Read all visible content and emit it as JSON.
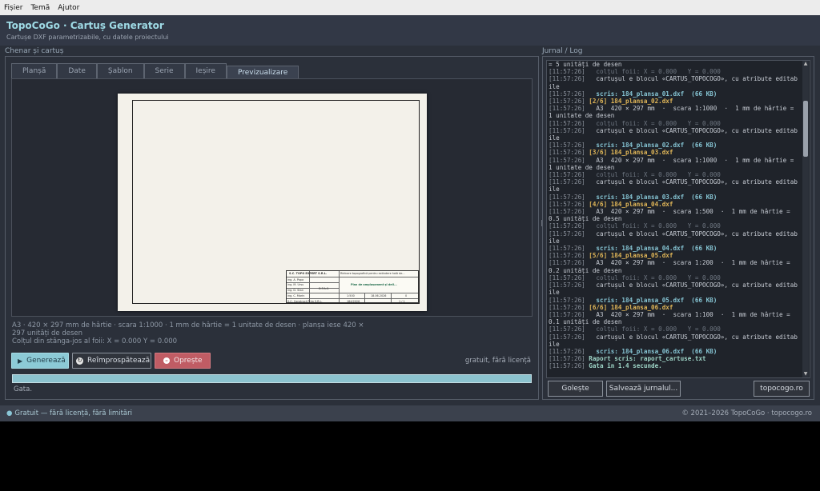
{
  "menu": {
    "file": "Fișier",
    "theme": "Temă",
    "help": "Ajutor"
  },
  "header": {
    "title": "TopoCoGo · Cartuș Generator",
    "subtitle": "Cartușe DXF parametrizabile, cu datele proiectului"
  },
  "left_panel": {
    "label": "Chenar și cartuș",
    "tabs": [
      "Planșă",
      "Date",
      "Șablon",
      "Serie",
      "Ieșire",
      "Previzualizare"
    ],
    "active_tab": "Previzualizare",
    "info_line1": "A3  ·  420 × 297 mm de hârtie  ·  scara 1:1000  ·  1 mm de hârtie = 1 unitate de desen  ·  planșa iese 420 ×",
    "info_line2": "297 unități de desen",
    "info_line3": "Colțul din stânga-jos al foii: X = 0.000   Y = 0.000",
    "buttons": {
      "generate": "Generează",
      "refresh": "Reîmprospătează",
      "stop": "Oprește"
    },
    "license_note": "gratuit, fără licență",
    "progress": 1.0,
    "status": "Gata."
  },
  "stamp": {
    "company": "S.C. TOPO EXPERT S.R.L.",
    "purpose": "Ridicare topografică pentru extindere hală de...",
    "names": [
      "ing. A. Popa",
      "ing. M. Ursu",
      "ing. D. Stan",
      "ing. C. Marin"
    ],
    "client": "S.C. Construct Prim S.R.L.",
    "phase": "D.T.A.C.",
    "plan_title": "Plan de amplasament și deli...",
    "scale": "1:500",
    "date": "18.06.2026",
    "sheet_no": "0",
    "project_no": "184/2026",
    "sheets": "1 / 1"
  },
  "right_panel": {
    "label": "Jurnal / Log",
    "log": [
      {
        "ts": "",
        "parts": [
          [
            "txt",
            "= 5 unități de desen"
          ]
        ]
      },
      {
        "ts": "[11:57:26]",
        "parts": [
          [
            "dim",
            "   colțul foii: X = 0.000   Y = 0.000"
          ]
        ]
      },
      {
        "ts": "[11:57:26]",
        "parts": [
          [
            "txt",
            "   cartușul e blocul «CARTUS_TOPOCOGO», cu atribute editabile"
          ]
        ]
      },
      {
        "ts": "[11:57:26]",
        "parts": [
          [
            "ok",
            "   scris: 184_plansa_01.dxf  (66 KB)"
          ]
        ]
      },
      {
        "ts": "[11:57:26]",
        "parts": [
          [
            "hdr",
            " [2/6] 184_plansa_02.dxf"
          ]
        ]
      },
      {
        "ts": "[11:57:26]",
        "parts": [
          [
            "txt",
            "   A3  420 × 297 mm  ·  scara 1:1000  ·  1 mm de hârtie = 1 unitate de desen"
          ]
        ]
      },
      {
        "ts": "[11:57:26]",
        "parts": [
          [
            "dim",
            "   colțul foii: X = 0.000   Y = 0.000"
          ]
        ]
      },
      {
        "ts": "[11:57:26]",
        "parts": [
          [
            "txt",
            "   cartușul e blocul «CARTUS_TOPOCOGO», cu atribute editabile"
          ]
        ]
      },
      {
        "ts": "[11:57:26]",
        "parts": [
          [
            "ok",
            "   scris: 184_plansa_02.dxf  (66 KB)"
          ]
        ]
      },
      {
        "ts": "[11:57:26]",
        "parts": [
          [
            "hdr",
            " [3/6] 184_plansa_03.dxf"
          ]
        ]
      },
      {
        "ts": "[11:57:26]",
        "parts": [
          [
            "txt",
            "   A3  420 × 297 mm  ·  scara 1:1000  ·  1 mm de hârtie = 1 unitate de desen"
          ]
        ]
      },
      {
        "ts": "[11:57:26]",
        "parts": [
          [
            "dim",
            "   colțul foii: X = 0.000   Y = 0.000"
          ]
        ]
      },
      {
        "ts": "[11:57:26]",
        "parts": [
          [
            "txt",
            "   cartușul e blocul «CARTUS_TOPOCOGO», cu atribute editabile"
          ]
        ]
      },
      {
        "ts": "[11:57:26]",
        "parts": [
          [
            "ok",
            "   scris: 184_plansa_03.dxf  (66 KB)"
          ]
        ]
      },
      {
        "ts": "[11:57:26]",
        "parts": [
          [
            "hdr",
            " [4/6] 184_plansa_04.dxf"
          ]
        ]
      },
      {
        "ts": "[11:57:26]",
        "parts": [
          [
            "txt",
            "   A3  420 × 297 mm  ·  scara 1:500  ·  1 mm de hârtie = 0.5 unități de desen"
          ]
        ]
      },
      {
        "ts": "[11:57:26]",
        "parts": [
          [
            "dim",
            "   colțul foii: X = 0.000   Y = 0.000"
          ]
        ]
      },
      {
        "ts": "[11:57:26]",
        "parts": [
          [
            "txt",
            "   cartușul e blocul «CARTUS_TOPOCOGO», cu atribute editabile"
          ]
        ]
      },
      {
        "ts": "[11:57:26]",
        "parts": [
          [
            "ok",
            "   scris: 184_plansa_04.dxf  (66 KB)"
          ]
        ]
      },
      {
        "ts": "[11:57:26]",
        "parts": [
          [
            "hdr",
            " [5/6] 184_plansa_05.dxf"
          ]
        ]
      },
      {
        "ts": "[11:57:26]",
        "parts": [
          [
            "txt",
            "   A3  420 × 297 mm  ·  scara 1:200  ·  1 mm de hârtie = 0.2 unități de desen"
          ]
        ]
      },
      {
        "ts": "[11:57:26]",
        "parts": [
          [
            "dim",
            "   colțul foii: X = 0.000   Y = 0.000"
          ]
        ]
      },
      {
        "ts": "[11:57:26]",
        "parts": [
          [
            "txt",
            "   cartușul e blocul «CARTUS_TOPOCOGO», cu atribute editabile"
          ]
        ]
      },
      {
        "ts": "[11:57:26]",
        "parts": [
          [
            "ok",
            "   scris: 184_plansa_05.dxf  (66 KB)"
          ]
        ]
      },
      {
        "ts": "[11:57:26]",
        "parts": [
          [
            "hdr",
            " [6/6] 184_plansa_06.dxf"
          ]
        ]
      },
      {
        "ts": "[11:57:26]",
        "parts": [
          [
            "txt",
            "   A3  420 × 297 mm  ·  scara 1:100  ·  1 mm de hârtie = 0.1 unități de desen"
          ]
        ]
      },
      {
        "ts": "[11:57:26]",
        "parts": [
          [
            "dim",
            "   colțul foii: X = 0.000   Y = 0.000"
          ]
        ]
      },
      {
        "ts": "[11:57:26]",
        "parts": [
          [
            "txt",
            "   cartușul e blocul «CARTUS_TOPOCOGO», cu atribute editabile"
          ]
        ]
      },
      {
        "ts": "[11:57:26]",
        "parts": [
          [
            "ok",
            "   scris: 184_plansa_06.dxf  (66 KB)"
          ]
        ]
      },
      {
        "ts": "[11:57:26]",
        "parts": [
          [
            "fin",
            " Raport scris: raport_cartuse.txt"
          ]
        ]
      },
      {
        "ts": "[11:57:26]",
        "parts": [
          [
            "fin",
            " Gata în 1.4 secunde."
          ]
        ]
      }
    ],
    "buttons": {
      "clear": "Golește",
      "save_log": "Salvează jurnalul...",
      "site": "topocogo.ro"
    }
  },
  "footer": {
    "left": "Gratuit — fără licență, fără limitări",
    "right": "© 2021–2026 TopoCoGo · topocogo.ro"
  }
}
